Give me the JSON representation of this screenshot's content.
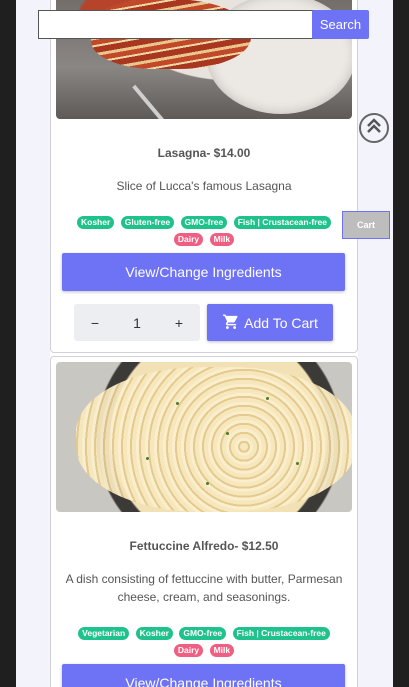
{
  "search": {
    "placeholder": "",
    "value": "",
    "button_label": "Search"
  },
  "floating": {
    "cart_label": "Cart",
    "scroll_top_icon": "double-chevron-up-icon"
  },
  "items": [
    {
      "title": "Lasagna- $14.00",
      "description": "Slice of Lucca's famous Lasagna",
      "tags_green": [
        "Kosher",
        "Gluten-free",
        "GMO-free",
        "Fish | Crustacean-free"
      ],
      "tags_pink": [
        "Dairy",
        "Milk"
      ],
      "ingredients_label": "View/Change Ingredients",
      "quantity": "1",
      "minus_label": "−",
      "plus_label": "+",
      "add_label": "Add To Cart"
    },
    {
      "title": "Fettuccine Alfredo- $12.50",
      "description": "A dish consisting of fettuccine with butter, Parmesan cheese, cream, and seasonings.",
      "tags_green": [
        "Vegetarian",
        "Kosher",
        "GMO-free",
        "Fish | Crustacean-free"
      ],
      "tags_pink": [
        "Dairy",
        "Milk"
      ],
      "ingredients_label": "View/Change Ingredients"
    }
  ],
  "colors": {
    "accent": "#6e72f5",
    "tag_green": "#1fc28b",
    "tag_pink": "#ee5f82"
  }
}
